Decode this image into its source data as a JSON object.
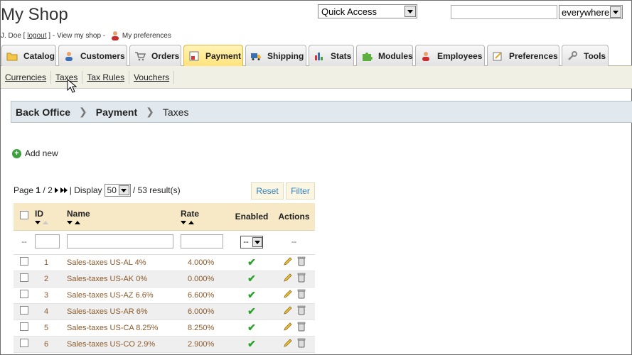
{
  "header": {
    "shop_name": "My Shop",
    "user_name": "J. Doe",
    "logout_prefix": " [ ",
    "logout_label": "logout",
    "view_shop": " ] - View my shop - ",
    "preferences_label": "My preferences",
    "quick_access": "Quick Access",
    "search_value": "",
    "search_scope": "everywhere"
  },
  "tabs": [
    {
      "label": "Catalog",
      "icon": "folder-icon"
    },
    {
      "label": "Customers",
      "icon": "user-icon"
    },
    {
      "label": "Orders",
      "icon": "cart-icon"
    },
    {
      "label": "Payment",
      "icon": "payment-icon",
      "active": true
    },
    {
      "label": "Shipping",
      "icon": "truck-icon"
    },
    {
      "label": "Stats",
      "icon": "bar-chart-icon"
    },
    {
      "label": "Modules",
      "icon": "puzzle-icon"
    },
    {
      "label": "Employees",
      "icon": "employee-icon"
    },
    {
      "label": "Preferences",
      "icon": "preferences-icon"
    },
    {
      "label": "Tools",
      "icon": "wrench-icon"
    }
  ],
  "subnav": [
    "Currencies",
    "Taxes",
    "Tax Rules",
    "Vouchers"
  ],
  "breadcrumb": {
    "root": "Back Office",
    "section": "Payment",
    "current": "Taxes"
  },
  "add_new": "Add new",
  "pager": {
    "page_label": "Page",
    "page": "1",
    "of": "/ 2",
    "display_label": "| Display",
    "display_value": "50",
    "results": "/ 53 result(s)"
  },
  "buttons": {
    "reset": "Reset",
    "filter": "Filter"
  },
  "table": {
    "columns": {
      "id": "ID",
      "name": "Name",
      "rate": "Rate",
      "enabled": "Enabled",
      "actions": "Actions"
    },
    "filter_row": {
      "check_placeholder": "--",
      "enabled_value": "--",
      "actions_placeholder": "--"
    },
    "rows": [
      {
        "id": "1",
        "name": "Sales-taxes US-AL 4%",
        "rate": "4.000%"
      },
      {
        "id": "2",
        "name": "Sales-taxes US-AK 0%",
        "rate": "0.000%"
      },
      {
        "id": "3",
        "name": "Sales-taxes US-AZ 6.6%",
        "rate": "6.600%"
      },
      {
        "id": "4",
        "name": "Sales-taxes US-AR 6%",
        "rate": "6.000%"
      },
      {
        "id": "5",
        "name": "Sales-taxes US-CA 8.25%",
        "rate": "8.250%"
      },
      {
        "id": "6",
        "name": "Sales-taxes US-CO 2.9%",
        "rate": "2.900%"
      }
    ]
  },
  "colors": {
    "accent_tab": "#ffe27a",
    "link_brown": "#8a5a2b",
    "button_text": "#2e7fc4",
    "check_green": "#2aa12a"
  }
}
